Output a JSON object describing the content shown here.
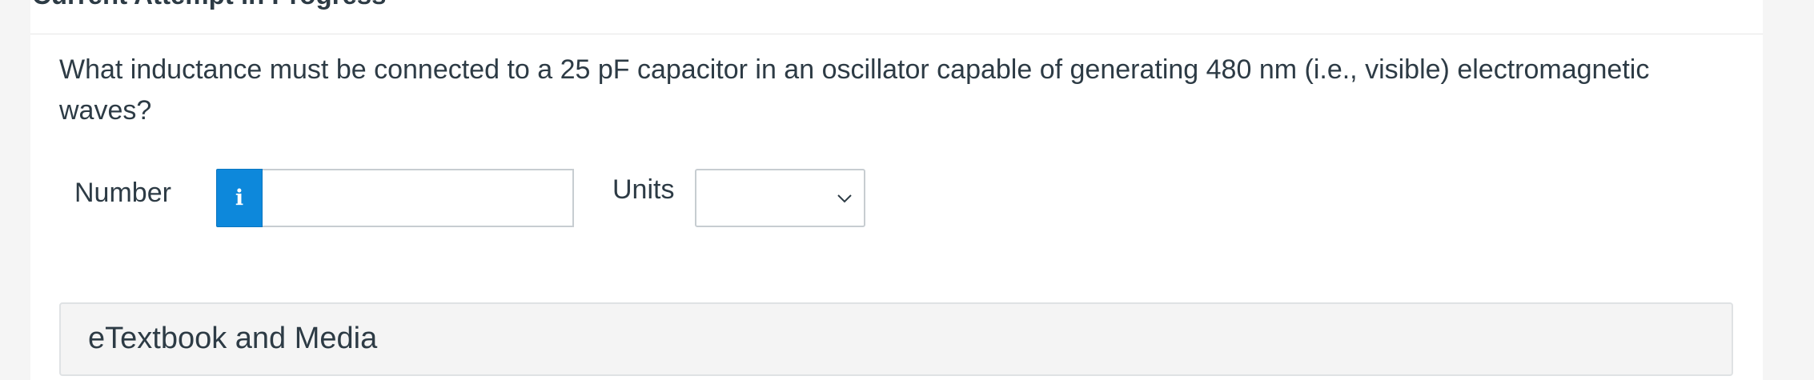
{
  "header": {
    "title": "Current Attempt in Progress"
  },
  "question": {
    "text": "What inductance must be connected to a 25 pF capacitor in an oscillator capable of generating 480 nm (i.e., visible) electromagnetic waves?"
  },
  "answer": {
    "number_label": "Number",
    "info_glyph": "i",
    "number_value": "",
    "units_label": "Units",
    "units_selected": ""
  },
  "resources": {
    "etextbook_label": "eTextbook and Media"
  },
  "icons": {
    "info": "info-icon",
    "units_dropdown": "chevron-down-icon"
  },
  "colors": {
    "info_button": "#0d88db",
    "text": "#2d3b45",
    "panel_background": "#ffffff",
    "page_background": "#f5f5f5"
  }
}
